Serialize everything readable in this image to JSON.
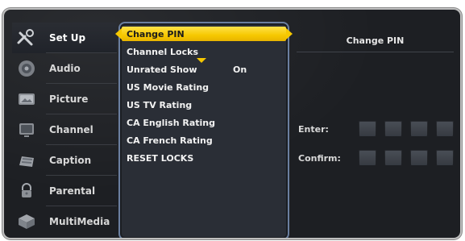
{
  "left_menu": {
    "items": [
      {
        "label": "Set Up",
        "icon": "wrench-icon"
      },
      {
        "label": "Audio",
        "icon": "speaker-icon"
      },
      {
        "label": "Picture",
        "icon": "picture-icon"
      },
      {
        "label": "Channel",
        "icon": "tv-icon"
      },
      {
        "label": "Caption",
        "icon": "caption-icon"
      },
      {
        "label": "Parental",
        "icon": "lock-icon"
      },
      {
        "label": "MultiMedia",
        "icon": "multimedia-icon"
      }
    ],
    "active_index": 0
  },
  "center_menu": {
    "items": [
      {
        "label": "Change PIN",
        "selected": true
      },
      {
        "label": "Channel Locks"
      },
      {
        "label": "Unrated Show",
        "value": "On"
      },
      {
        "label": "US Movie Rating"
      },
      {
        "label": "US TV Rating"
      },
      {
        "label": "CA English Rating"
      },
      {
        "label": "CA French Rating"
      },
      {
        "label": "RESET LOCKS"
      }
    ]
  },
  "right_panel": {
    "title": "Change PIN",
    "enter_label": "Enter:",
    "confirm_label": "Confirm:"
  },
  "colors": {
    "accent": "#f6c800",
    "panel_border": "#6b7fa0"
  }
}
